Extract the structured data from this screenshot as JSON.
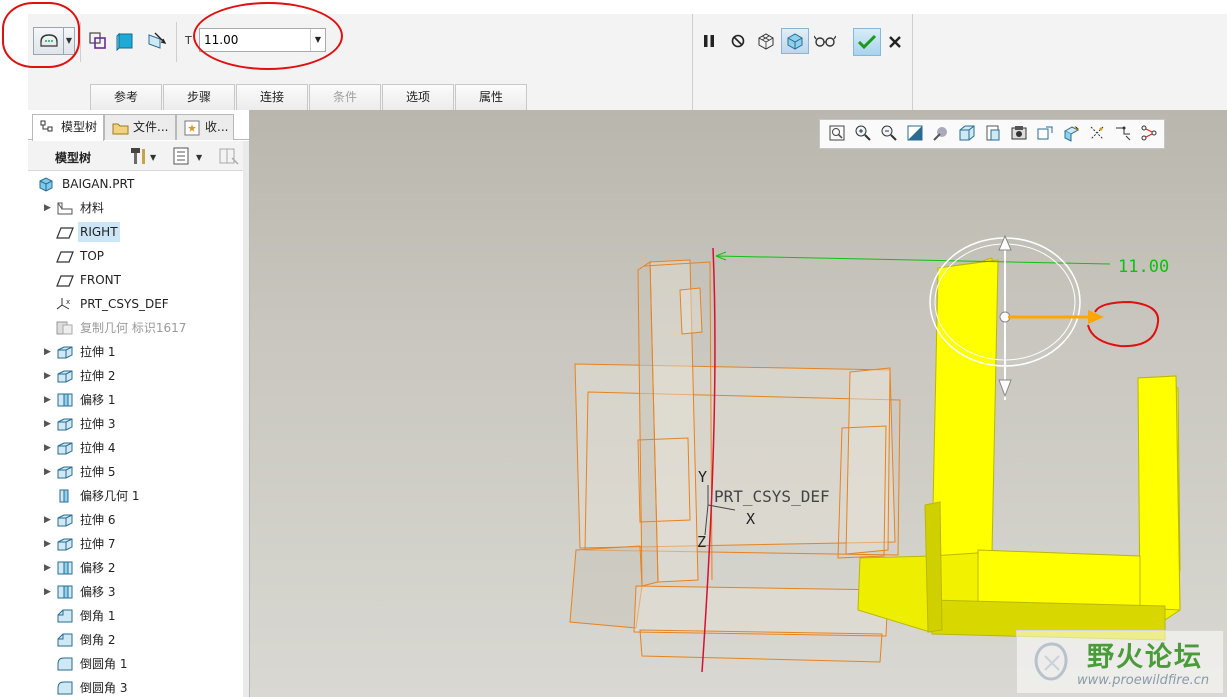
{
  "dashboard": {
    "sketch_button": "sketch-sweep-icon",
    "depth_label": "T",
    "depth_value": "11.00",
    "tabs": [
      "参考",
      "步骤",
      "连接",
      "条件",
      "选项",
      "属性"
    ],
    "disabled_tab": "条件",
    "right_icons": [
      "pause-icon",
      "no-preview-icon",
      "verify-mesh-icon",
      "feature-preview-icon",
      "glasses-icon"
    ],
    "ok_icon": "checkmark-icon",
    "cancel_icon": "x-icon"
  },
  "panel": {
    "tabs": [
      {
        "label": "模型树",
        "icon": "model-tree-icon"
      },
      {
        "label": "文件...",
        "icon": "folder-icon"
      },
      {
        "label": "收...",
        "icon": "favorites-icon"
      }
    ],
    "toolbar_label": "模型树",
    "tree": [
      {
        "label": "BAIGAN.PRT",
        "icon": "part-icon",
        "indent": 0,
        "arrow": false
      },
      {
        "label": "材料",
        "icon": "material-icon",
        "indent": 1,
        "arrow": true
      },
      {
        "label": "RIGHT",
        "icon": "datum-plane-icon",
        "indent": 1,
        "arrow": false,
        "selected": true
      },
      {
        "label": "TOP",
        "icon": "datum-plane-icon",
        "indent": 1,
        "arrow": false
      },
      {
        "label": "FRONT",
        "icon": "datum-plane-icon",
        "indent": 1,
        "arrow": false
      },
      {
        "label": "PRT_CSYS_DEF",
        "icon": "csys-icon",
        "indent": 1,
        "arrow": false
      },
      {
        "label": "复制几何 标识1617",
        "icon": "copy-geometry-icon",
        "indent": 1,
        "arrow": false,
        "dim": true
      },
      {
        "label": "拉伸 1",
        "icon": "extrude-icon",
        "indent": 1,
        "arrow": true
      },
      {
        "label": "拉伸 2",
        "icon": "extrude-icon",
        "indent": 1,
        "arrow": true
      },
      {
        "label": "偏移 1",
        "icon": "offset-icon",
        "indent": 1,
        "arrow": true
      },
      {
        "label": "拉伸 3",
        "icon": "extrude-icon",
        "indent": 1,
        "arrow": true
      },
      {
        "label": "拉伸 4",
        "icon": "extrude-icon",
        "indent": 1,
        "arrow": true
      },
      {
        "label": "拉伸 5",
        "icon": "extrude-icon",
        "indent": 1,
        "arrow": true
      },
      {
        "label": "偏移几何 1",
        "icon": "offset-geometry-icon",
        "indent": 1,
        "arrow": false
      },
      {
        "label": "拉伸 6",
        "icon": "extrude-icon",
        "indent": 1,
        "arrow": true
      },
      {
        "label": "拉伸 7",
        "icon": "extrude-icon",
        "indent": 1,
        "arrow": true
      },
      {
        "label": "偏移 2",
        "icon": "offset-icon",
        "indent": 1,
        "arrow": true
      },
      {
        "label": "偏移 3",
        "icon": "offset-icon",
        "indent": 1,
        "arrow": true
      },
      {
        "label": "倒角 1",
        "icon": "chamfer-icon",
        "indent": 1,
        "arrow": false
      },
      {
        "label": "倒角 2",
        "icon": "chamfer-icon",
        "indent": 1,
        "arrow": false
      },
      {
        "label": "倒圆角 1",
        "icon": "round-icon",
        "indent": 1,
        "arrow": false
      },
      {
        "label": "倒圆角 3",
        "icon": "round-icon",
        "indent": 1,
        "arrow": false
      }
    ]
  },
  "graphics": {
    "dimension_value": "11.00",
    "csys_label": "PRT_CSYS_DEF",
    "axis_y": "Y",
    "axis_x": "X",
    "axis_z": "Z",
    "view_toolbar": [
      "refit-icon",
      "zoom-in-icon",
      "zoom-out-icon",
      "repaint-icon",
      "display-style-icon",
      "saved-views-icon",
      "view-manager-icon",
      "perspective-icon",
      "datum-display-icon",
      "plane-display-icon",
      "axis-display-icon",
      "point-display-icon",
      "csys-display-icon"
    ],
    "watermark_title": "野火论坛",
    "watermark_url": "www.proewildfire.cn",
    "colors": {
      "yellow": "#ffff00",
      "orange": "#e8821e",
      "green": "#10c010",
      "red": "#d81030"
    }
  }
}
